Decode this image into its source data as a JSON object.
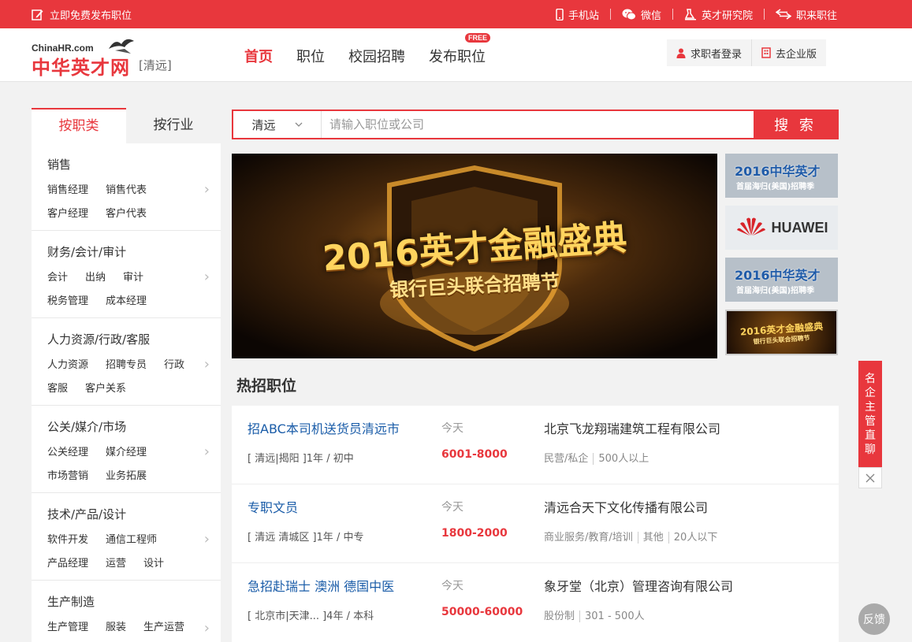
{
  "topbar": {
    "post_label": "立即免费发布职位",
    "links": [
      "手机站",
      "微信",
      "英才研究院",
      "职来职往"
    ]
  },
  "header": {
    "logo_en": "ChinaHR.com",
    "logo_cn": "中华英才网",
    "city": "[清远]",
    "nav": [
      "首页",
      "职位",
      "校园招聘",
      "发布职位"
    ],
    "free_badge": "FREE",
    "login_label": "求职者登录",
    "enterprise_label": "去企业版"
  },
  "category": {
    "tabs": [
      "按职类",
      "按行业"
    ],
    "groups": [
      {
        "title": "销售",
        "rows": [
          [
            "销售经理",
            "销售代表"
          ],
          [
            "客户经理",
            "客户代表"
          ]
        ]
      },
      {
        "title": "财务/会计/审计",
        "rows": [
          [
            "会计",
            "出纳",
            "审计"
          ],
          [
            "税务管理",
            "成本经理"
          ]
        ]
      },
      {
        "title": "人力资源/行政/客服",
        "rows": [
          [
            "人力资源",
            "招聘专员",
            "行政"
          ],
          [
            "客服",
            "客户关系"
          ]
        ]
      },
      {
        "title": "公关/媒介/市场",
        "rows": [
          [
            "公关经理",
            "媒介经理"
          ],
          [
            "市场营销",
            "业务拓展"
          ]
        ]
      },
      {
        "title": "技术/产品/设计",
        "rows": [
          [
            "软件开发",
            "通信工程师"
          ],
          [
            "产品经理",
            "运营",
            "设计"
          ]
        ]
      },
      {
        "title": "生产制造",
        "rows": [
          [
            "生产管理",
            "服装",
            "生产运营"
          ]
        ]
      }
    ]
  },
  "search": {
    "city": "清远",
    "placeholder": "请输入职位或公司",
    "button": "搜 索"
  },
  "banner": {
    "headline": "2016英才金融盛典",
    "subline": "银行巨头联合招聘节"
  },
  "thumbs": [
    {
      "line1": "2016中华英才",
      "line2": "首届海归(美国)招聘季"
    },
    {
      "line1": "HUAWEI"
    },
    {
      "line1": "2016中华英才",
      "line2": "首届海归(美国)招聘季"
    },
    {
      "line1": "2016英才金融盛典",
      "line2": "银行巨头联合招聘节"
    }
  ],
  "hot": {
    "title": "热招职位",
    "jobs": [
      {
        "title": "招ABC本司机送货员清远市",
        "date": "今天",
        "company": "北京飞龙翔瑞建筑工程有限公司",
        "location": "[ 清远|揭阳 ]1年 / 初中",
        "salary": "6001-8000",
        "tags": [
          "民营/私企",
          "500人以上"
        ]
      },
      {
        "title": "专职文员",
        "date": "今天",
        "company": "清远合天下文化传播有限公司",
        "location": "[ 清远 清城区 ]1年 / 中专",
        "salary": "1800-2000",
        "tags": [
          "商业服务/教育/培训",
          "其他",
          "20人以下"
        ]
      },
      {
        "title": "急招赴瑞士 澳洲 德国中医",
        "date": "今天",
        "company": "象牙堂（北京）管理咨询有限公司",
        "location": "[ 北京市|天津... ]4年 / 本科",
        "salary": "50000-60000",
        "tags": [
          "股份制",
          "301 - 500人"
        ]
      }
    ]
  },
  "float": {
    "chat_label": "名企主管直聊",
    "feedback": "反馈"
  },
  "colors": {
    "brand": "#e8373d",
    "link": "#1a5ca8"
  }
}
